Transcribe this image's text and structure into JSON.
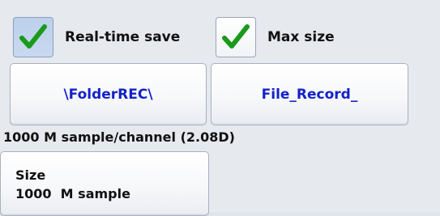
{
  "checkboxes": [
    {
      "label": "Real-time save",
      "checked": true,
      "state": "pressed"
    },
    {
      "label": "Max size",
      "checked": true,
      "state": "raised"
    }
  ],
  "buttons": {
    "folder": "\\FolderREC\\",
    "file": "File_Record_"
  },
  "info": "1000 M sample/channel (2.08D)",
  "size_button": {
    "title": "Size",
    "value": "1000  M sample"
  },
  "colors": {
    "accent_text": "#1422c8",
    "check_green": "#1a9a1a",
    "pressed_bg": "#c9d9ef"
  }
}
